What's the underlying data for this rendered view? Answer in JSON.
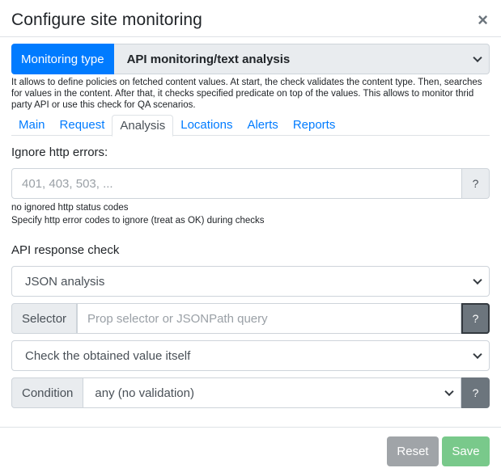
{
  "header": {
    "title": "Configure site monitoring",
    "close_label": "×"
  },
  "monitoring_type": {
    "label": "Monitoring type",
    "selected": "API monitoring/text analysis",
    "help": "It allows to define policies on fetched content values. At start, the check validates the content type. Then, searches for values in the content. After that, it checks specified predicate on top of the values. This allows to monitor thrid party API or use this check for QA scenarios."
  },
  "tabs": [
    {
      "label": "Main"
    },
    {
      "label": "Request"
    },
    {
      "label": "Analysis"
    },
    {
      "label": "Locations"
    },
    {
      "label": "Alerts"
    },
    {
      "label": "Reports"
    }
  ],
  "ignore_http": {
    "label": "Ignore http errors:",
    "placeholder": "401, 403, 503, ...",
    "help_button": "?",
    "status": "no ignored http status codes",
    "hint": "Specify http error codes to ignore (treat as OK) during checks"
  },
  "api_check": {
    "label": "API response check",
    "analysis_select": "JSON analysis",
    "selector_label": "Selector",
    "selector_placeholder": "Prop selector or JSONPath query",
    "selector_help": "?",
    "value_select": "Check the obtained value itself",
    "condition_label": "Condition",
    "condition_select": "any (no validation)",
    "condition_help": "?"
  },
  "footer": {
    "reset_label": "Reset",
    "save_label": "Save"
  },
  "colors": {
    "primary": "#007bff",
    "secondary": "#6c757d",
    "save_disabled": "#79c98b",
    "reset_disabled": "#a0a4a8"
  }
}
